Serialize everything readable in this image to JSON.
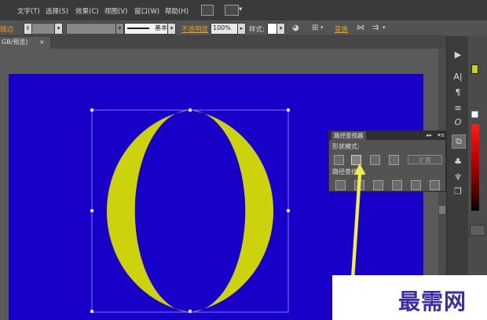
{
  "menu": {
    "items": [
      "文字(T)",
      "选择(S)",
      "效果(C)",
      "视图(V)",
      "窗口(W)",
      "帮助(H)"
    ]
  },
  "control_bar": {
    "left_label": "描边",
    "stroke_profile": "基本",
    "opacity_label": "不透明度",
    "opacity_value": "100%",
    "style_label": "样式:",
    "transform_label": "变换"
  },
  "tabs": {
    "document": "GB/预览)",
    "close_glyph": "×"
  },
  "tools": [
    {
      "name": "play-icon",
      "glyph": "▶"
    },
    {
      "name": "character-icon",
      "glyph": "A|"
    },
    {
      "name": "paragraph-icon",
      "glyph": "¶"
    },
    {
      "name": "align-icon",
      "glyph": "≡"
    },
    {
      "name": "opentype-icon",
      "glyph": "O"
    },
    {
      "name": "pathfinder-tool-icon",
      "glyph": "⧉"
    },
    {
      "name": "symbols-icon",
      "glyph": "♣"
    },
    {
      "name": "brush-icon",
      "glyph": "♆"
    },
    {
      "name": "layers-icon",
      "glyph": "❐"
    }
  ],
  "pathfinder": {
    "title": "路径查找器",
    "shape_modes_label": "形状模式:",
    "expand_label": "扩展",
    "pathfinders_label": "路径查找器:"
  },
  "artwork": {
    "background_color": "#1900c8",
    "shape_color": "#ccd20b",
    "arrow_color": "#f2ef4a"
  },
  "watermark": {
    "text": "最需网"
  }
}
